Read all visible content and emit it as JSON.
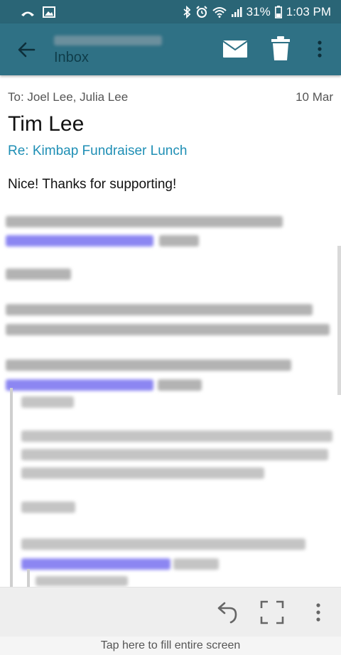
{
  "status_bar": {
    "battery": "31%",
    "time": "1:03 PM"
  },
  "app_bar": {
    "subtitle": "Inbox"
  },
  "message": {
    "recipients": "To: Joel Lee, Julia Lee",
    "date": "10 Mar",
    "sender": "Tim Lee",
    "subject": "Re: Kimbap Fundraiser Lunch",
    "body": "Nice! Thanks for supporting!"
  },
  "hint": "Tap here to fill entire screen",
  "colors": {
    "status_bar": "#2a6576",
    "app_bar": "#2f7185",
    "subject": "#1f8fb5",
    "link_blur": "#8c86f2"
  }
}
